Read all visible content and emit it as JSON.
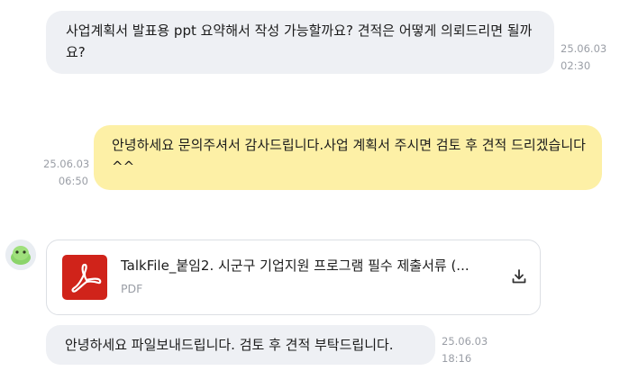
{
  "messages": [
    {
      "text": "사업계획서 발표용 ppt 요약해서 작성 가능할까요? 견적은 어떻게 의뢰드리면 될까요?",
      "date": "25.06.03",
      "time": "02:30"
    },
    {
      "text": "안녕하세요 문의주셔서 감사드립니다.사업 계획서 주시면 검토 후 견적 드리겠습니다^^",
      "date": "25.06.03",
      "time": "06:50"
    },
    {
      "file_name": "TalkFile_붙임2. 시군구 기업지원 프로그램 필수 제출서류 (...",
      "file_type": "PDF",
      "text": "안녕하세요 파일보내드립니다. 검토 후 견적 부탁드립니다.",
      "date": "25.06.03",
      "time": "18:16"
    }
  ],
  "icons": {
    "avatar": "green-character-avatar",
    "file": "pdf-icon",
    "download": "download-icon"
  },
  "colors": {
    "incoming_bubble": "#eef0f4",
    "outgoing_bubble": "#fdf0a6",
    "pdf_red": "#d0231a",
    "timestamp": "#9a9ea6"
  }
}
